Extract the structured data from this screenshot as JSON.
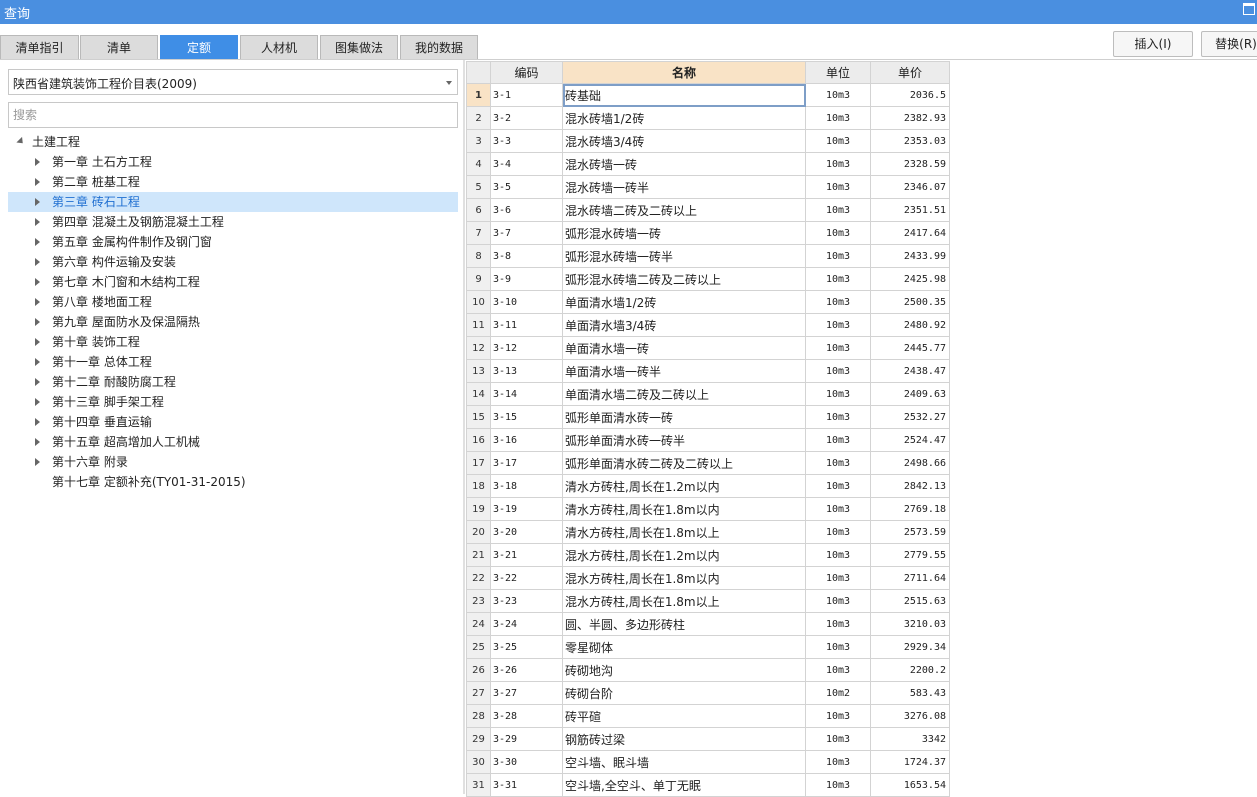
{
  "window": {
    "title": "查询"
  },
  "tabs": [
    {
      "label": "清单指引"
    },
    {
      "label": "清单"
    },
    {
      "label": "定额"
    },
    {
      "label": "人材机"
    },
    {
      "label": "图集做法"
    },
    {
      "label": "我的数据"
    }
  ],
  "active_tab": "定额",
  "buttons": {
    "insert": "插入(I)",
    "replace": "替换(R)"
  },
  "left": {
    "combo_value": "陕西省建筑装饰工程价目表(2009)",
    "search_placeholder": "搜索",
    "tree_root": "土建工程",
    "tree_items": [
      {
        "label": "第一章 土石方工程",
        "has_children": true
      },
      {
        "label": "第二章 桩基工程",
        "has_children": true
      },
      {
        "label": "第三章 砖石工程",
        "has_children": true
      },
      {
        "label": "第四章 混凝土及钢筋混凝土工程",
        "has_children": true
      },
      {
        "label": "第五章 金属构件制作及钢门窗",
        "has_children": true
      },
      {
        "label": "第六章 构件运输及安装",
        "has_children": true
      },
      {
        "label": "第七章 木门窗和木结构工程",
        "has_children": true
      },
      {
        "label": "第八章 楼地面工程",
        "has_children": true
      },
      {
        "label": "第九章 屋面防水及保温隔热",
        "has_children": true
      },
      {
        "label": "第十章 装饰工程",
        "has_children": true
      },
      {
        "label": "第十一章 总体工程",
        "has_children": true
      },
      {
        "label": "第十二章 耐酸防腐工程",
        "has_children": true
      },
      {
        "label": "第十三章 脚手架工程",
        "has_children": true
      },
      {
        "label": "第十四章 垂直运输",
        "has_children": true
      },
      {
        "label": "第十五章 超高增加人工机械",
        "has_children": true
      },
      {
        "label": "第十六章 附录",
        "has_children": true
      },
      {
        "label": "第十七章 定额补充(TY01-31-2015)",
        "has_children": false
      }
    ],
    "selected_item": "第三章 砖石工程"
  },
  "table": {
    "headers": {
      "code": "编码",
      "name": "名称",
      "unit": "单位",
      "price": "单价"
    },
    "rows": [
      {
        "n": "1",
        "code": "3-1",
        "name": "砖基础",
        "unit": "10m3",
        "price": "2036.5"
      },
      {
        "n": "2",
        "code": "3-2",
        "name": "混水砖墙1/2砖",
        "unit": "10m3",
        "price": "2382.93"
      },
      {
        "n": "3",
        "code": "3-3",
        "name": "混水砖墙3/4砖",
        "unit": "10m3",
        "price": "2353.03"
      },
      {
        "n": "4",
        "code": "3-4",
        "name": "混水砖墙一砖",
        "unit": "10m3",
        "price": "2328.59"
      },
      {
        "n": "5",
        "code": "3-5",
        "name": "混水砖墙一砖半",
        "unit": "10m3",
        "price": "2346.07"
      },
      {
        "n": "6",
        "code": "3-6",
        "name": "混水砖墙二砖及二砖以上",
        "unit": "10m3",
        "price": "2351.51"
      },
      {
        "n": "7",
        "code": "3-7",
        "name": "弧形混水砖墙一砖",
        "unit": "10m3",
        "price": "2417.64"
      },
      {
        "n": "8",
        "code": "3-8",
        "name": "弧形混水砖墙一砖半",
        "unit": "10m3",
        "price": "2433.99"
      },
      {
        "n": "9",
        "code": "3-9",
        "name": "弧形混水砖墙二砖及二砖以上",
        "unit": "10m3",
        "price": "2425.98"
      },
      {
        "n": "10",
        "code": "3-10",
        "name": "单面清水墙1/2砖",
        "unit": "10m3",
        "price": "2500.35"
      },
      {
        "n": "11",
        "code": "3-11",
        "name": "单面清水墙3/4砖",
        "unit": "10m3",
        "price": "2480.92"
      },
      {
        "n": "12",
        "code": "3-12",
        "name": "单面清水墙一砖",
        "unit": "10m3",
        "price": "2445.77"
      },
      {
        "n": "13",
        "code": "3-13",
        "name": "单面清水墙一砖半",
        "unit": "10m3",
        "price": "2438.47"
      },
      {
        "n": "14",
        "code": "3-14",
        "name": "单面清水墙二砖及二砖以上",
        "unit": "10m3",
        "price": "2409.63"
      },
      {
        "n": "15",
        "code": "3-15",
        "name": "弧形单面清水砖一砖",
        "unit": "10m3",
        "price": "2532.27"
      },
      {
        "n": "16",
        "code": "3-16",
        "name": "弧形单面清水砖一砖半",
        "unit": "10m3",
        "price": "2524.47"
      },
      {
        "n": "17",
        "code": "3-17",
        "name": "弧形单面清水砖二砖及二砖以上",
        "unit": "10m3",
        "price": "2498.66"
      },
      {
        "n": "18",
        "code": "3-18",
        "name": "清水方砖柱,周长在1.2m以内",
        "unit": "10m3",
        "price": "2842.13"
      },
      {
        "n": "19",
        "code": "3-19",
        "name": "清水方砖柱,周长在1.8m以内",
        "unit": "10m3",
        "price": "2769.18"
      },
      {
        "n": "20",
        "code": "3-20",
        "name": "清水方砖柱,周长在1.8m以上",
        "unit": "10m3",
        "price": "2573.59"
      },
      {
        "n": "21",
        "code": "3-21",
        "name": "混水方砖柱,周长在1.2m以内",
        "unit": "10m3",
        "price": "2779.55"
      },
      {
        "n": "22",
        "code": "3-22",
        "name": "混水方砖柱,周长在1.8m以内",
        "unit": "10m3",
        "price": "2711.64"
      },
      {
        "n": "23",
        "code": "3-23",
        "name": "混水方砖柱,周长在1.8m以上",
        "unit": "10m3",
        "price": "2515.63"
      },
      {
        "n": "24",
        "code": "3-24",
        "name": "圆、半圆、多边形砖柱",
        "unit": "10m3",
        "price": "3210.03"
      },
      {
        "n": "25",
        "code": "3-25",
        "name": "零星砌体",
        "unit": "10m3",
        "price": "2929.34"
      },
      {
        "n": "26",
        "code": "3-26",
        "name": "砖砌地沟",
        "unit": "10m3",
        "price": "2200.2"
      },
      {
        "n": "27",
        "code": "3-27",
        "name": "砖砌台阶",
        "unit": "10m2",
        "price": "583.43"
      },
      {
        "n": "28",
        "code": "3-28",
        "name": "砖平碹",
        "unit": "10m3",
        "price": "3276.08"
      },
      {
        "n": "29",
        "code": "3-29",
        "name": "钢筋砖过梁",
        "unit": "10m3",
        "price": "3342"
      },
      {
        "n": "30",
        "code": "3-30",
        "name": "空斗墙、眠斗墙",
        "unit": "10m3",
        "price": "1724.37"
      },
      {
        "n": "31",
        "code": "3-31",
        "name": "空斗墙,全空斗、单丁无眠",
        "unit": "10m3",
        "price": "1653.54"
      }
    ]
  }
}
